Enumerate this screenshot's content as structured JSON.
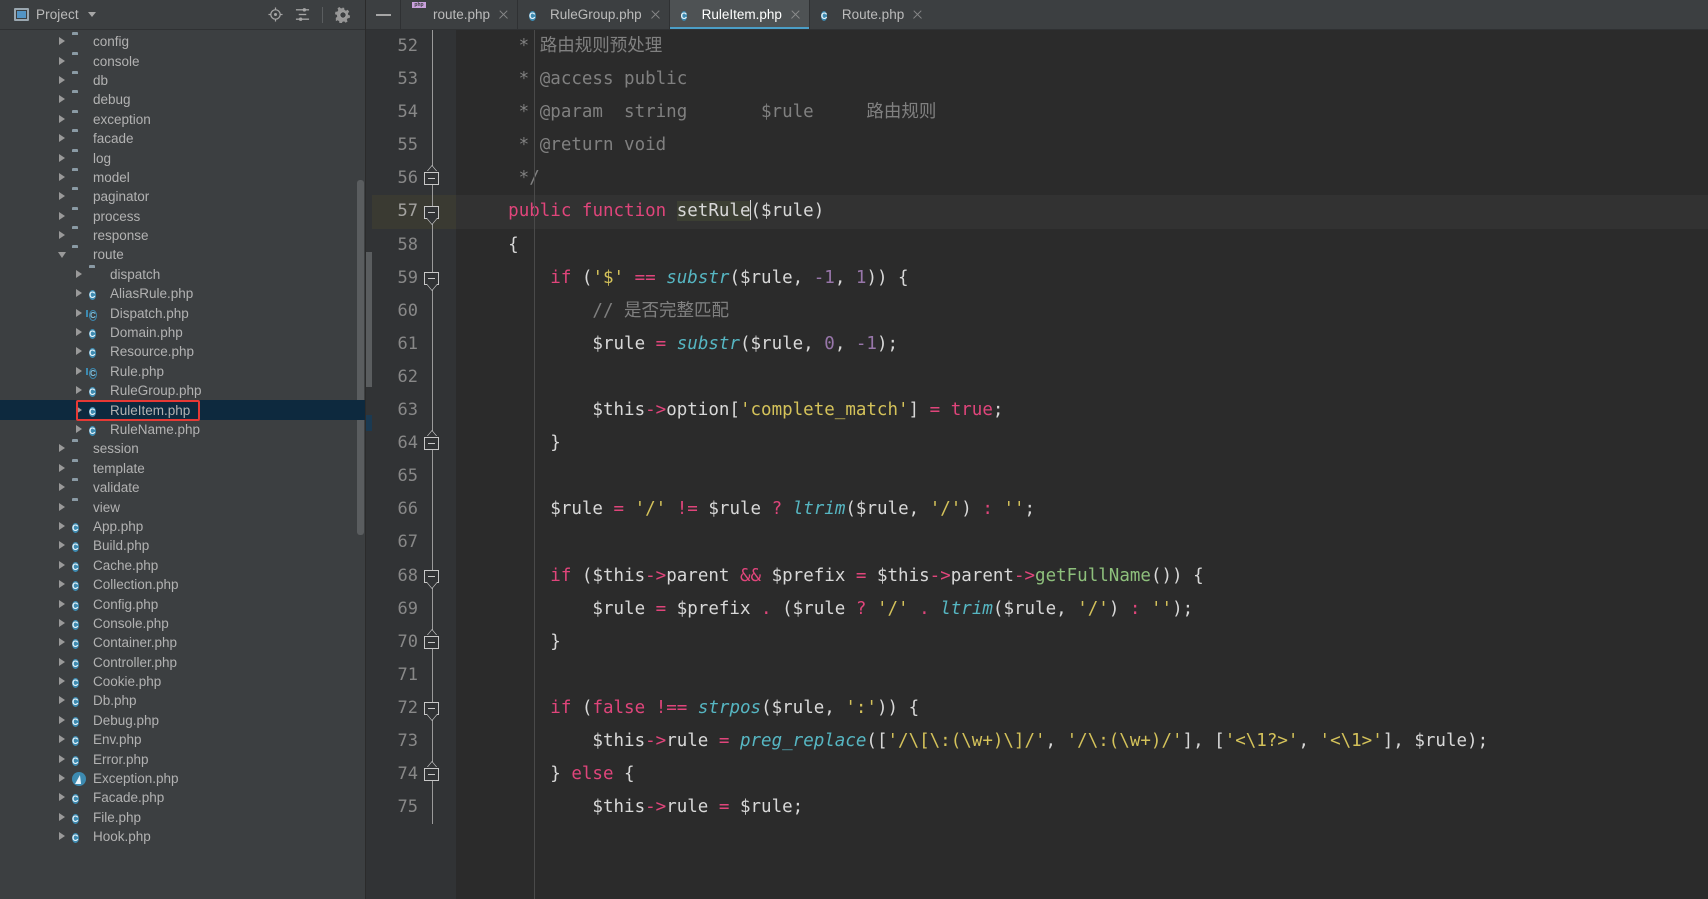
{
  "sidebar": {
    "title": "Project",
    "title_icon": "project-panel-icon",
    "actions": [
      {
        "name": "locate-icon",
        "label": "Select Opened File"
      },
      {
        "name": "collapse-all-icon",
        "label": "Collapse All"
      },
      {
        "name": "gear-icon",
        "label": "Settings"
      }
    ],
    "tree": [
      {
        "label": "config",
        "icon": "folder-icon",
        "arrow": "closed",
        "indent": 1
      },
      {
        "label": "console",
        "icon": "folder-icon",
        "arrow": "closed",
        "indent": 1
      },
      {
        "label": "db",
        "icon": "folder-icon",
        "arrow": "closed",
        "indent": 1
      },
      {
        "label": "debug",
        "icon": "folder-icon",
        "arrow": "closed",
        "indent": 1
      },
      {
        "label": "exception",
        "icon": "folder-icon",
        "arrow": "closed",
        "indent": 1
      },
      {
        "label": "facade",
        "icon": "folder-icon",
        "arrow": "closed",
        "indent": 1
      },
      {
        "label": "log",
        "icon": "folder-icon",
        "arrow": "closed",
        "indent": 1
      },
      {
        "label": "model",
        "icon": "folder-icon",
        "arrow": "closed",
        "indent": 1
      },
      {
        "label": "paginator",
        "icon": "folder-icon",
        "arrow": "closed",
        "indent": 1
      },
      {
        "label": "process",
        "icon": "folder-icon",
        "arrow": "closed",
        "indent": 1
      },
      {
        "label": "response",
        "icon": "folder-icon",
        "arrow": "closed",
        "indent": 1
      },
      {
        "label": "route",
        "icon": "folder-icon",
        "arrow": "open",
        "indent": 1
      },
      {
        "label": "dispatch",
        "icon": "folder-icon",
        "arrow": "closed",
        "indent": 2
      },
      {
        "label": "AliasRule.php",
        "icon": "php-class-icon",
        "arrow": "closed",
        "indent": 2
      },
      {
        "label": "Dispatch.php",
        "icon": "php-abstract-class-icon",
        "arrow": "closed",
        "indent": 2
      },
      {
        "label": "Domain.php",
        "icon": "php-class-icon",
        "arrow": "closed",
        "indent": 2
      },
      {
        "label": "Resource.php",
        "icon": "php-class-icon",
        "arrow": "closed",
        "indent": 2
      },
      {
        "label": "Rule.php",
        "icon": "php-abstract-class-icon",
        "arrow": "closed",
        "indent": 2
      },
      {
        "label": "RuleGroup.php",
        "icon": "php-class-icon",
        "arrow": "closed",
        "indent": 2
      },
      {
        "label": "RuleItem.php",
        "icon": "php-class-icon",
        "arrow": "closed",
        "indent": 2,
        "selected": true,
        "annotated": true
      },
      {
        "label": "RuleName.php",
        "icon": "php-class-icon",
        "arrow": "closed",
        "indent": 2
      },
      {
        "label": "session",
        "icon": "folder-icon",
        "arrow": "closed",
        "indent": 1
      },
      {
        "label": "template",
        "icon": "folder-icon",
        "arrow": "closed",
        "indent": 1
      },
      {
        "label": "validate",
        "icon": "folder-icon",
        "arrow": "closed",
        "indent": 1
      },
      {
        "label": "view",
        "icon": "folder-icon",
        "arrow": "closed",
        "indent": 1
      },
      {
        "label": "App.php",
        "icon": "php-class-icon",
        "arrow": "closed",
        "indent": 1
      },
      {
        "label": "Build.php",
        "icon": "php-class-icon",
        "arrow": "closed",
        "indent": 1
      },
      {
        "label": "Cache.php",
        "icon": "php-class-icon",
        "arrow": "closed",
        "indent": 1
      },
      {
        "label": "Collection.php",
        "icon": "php-class-icon",
        "arrow": "closed",
        "indent": 1
      },
      {
        "label": "Config.php",
        "icon": "php-class-icon",
        "arrow": "closed",
        "indent": 1
      },
      {
        "label": "Console.php",
        "icon": "php-class-icon",
        "arrow": "closed",
        "indent": 1
      },
      {
        "label": "Container.php",
        "icon": "php-class-icon",
        "arrow": "closed",
        "indent": 1
      },
      {
        "label": "Controller.php",
        "icon": "php-class-icon",
        "arrow": "closed",
        "indent": 1
      },
      {
        "label": "Cookie.php",
        "icon": "php-class-icon",
        "arrow": "closed",
        "indent": 1
      },
      {
        "label": "Db.php",
        "icon": "php-class-icon",
        "arrow": "closed",
        "indent": 1
      },
      {
        "label": "Debug.php",
        "icon": "php-class-icon",
        "arrow": "closed",
        "indent": 1
      },
      {
        "label": "Env.php",
        "icon": "php-class-icon",
        "arrow": "closed",
        "indent": 1
      },
      {
        "label": "Error.php",
        "icon": "php-class-icon",
        "arrow": "closed",
        "indent": 1
      },
      {
        "label": "Exception.php",
        "icon": "php-exception-icon",
        "arrow": "closed",
        "indent": 1
      },
      {
        "label": "Facade.php",
        "icon": "php-class-icon",
        "arrow": "closed",
        "indent": 1
      },
      {
        "label": "File.php",
        "icon": "php-class-icon",
        "arrow": "closed",
        "indent": 1
      },
      {
        "label": "Hook.php",
        "icon": "php-class-icon",
        "arrow": "closed",
        "indent": 1
      }
    ]
  },
  "tabs": [
    {
      "label": "route.php",
      "icon": "php-file-icon",
      "active": false
    },
    {
      "label": "RuleGroup.php",
      "icon": "php-class-icon",
      "active": false
    },
    {
      "label": "RuleItem.php",
      "icon": "php-class-icon",
      "active": true
    },
    {
      "label": "Route.php",
      "icon": "php-class-icon",
      "active": false
    }
  ],
  "editor": {
    "current_line": 57,
    "first_line": 52,
    "lines": [
      {
        "n": 52,
        "fold": null,
        "tokens": [
          {
            "t": "     * ",
            "c": "c-com"
          },
          {
            "t": "路由规则预处理",
            "c": "c-com"
          }
        ]
      },
      {
        "n": 53,
        "fold": null,
        "tokens": [
          {
            "t": "     * @access public",
            "c": "c-com"
          }
        ]
      },
      {
        "n": 54,
        "fold": null,
        "tokens": [
          {
            "t": "     * @param  string       $rule     路由规则",
            "c": "c-com"
          }
        ]
      },
      {
        "n": 55,
        "fold": null,
        "tokens": [
          {
            "t": "     * @return void",
            "c": "c-com"
          }
        ]
      },
      {
        "n": 56,
        "fold": "end",
        "tokens": [
          {
            "t": "     */",
            "c": "c-com"
          }
        ]
      },
      {
        "n": 57,
        "fold": "start",
        "tokens": [
          {
            "t": "    ",
            "c": "c-def"
          },
          {
            "t": "public function ",
            "c": "c-kw2"
          },
          {
            "t": "setRule",
            "c": "c-white idhl"
          },
          {
            "t": "CARET",
            "c": "caret"
          },
          {
            "t": "($rule)",
            "c": "c-white"
          }
        ]
      },
      {
        "n": 58,
        "fold": null,
        "tokens": [
          {
            "t": "    {",
            "c": "c-white"
          }
        ]
      },
      {
        "n": 59,
        "fold": "start",
        "tokens": [
          {
            "t": "        ",
            "c": "c-def"
          },
          {
            "t": "if",
            "c": "c-kw2"
          },
          {
            "t": " (",
            "c": "c-white"
          },
          {
            "t": "'$'",
            "c": "c-str"
          },
          {
            "t": " ",
            "c": "c-def"
          },
          {
            "t": "==",
            "c": "c-op"
          },
          {
            "t": " ",
            "c": "c-def"
          },
          {
            "t": "substr",
            "c": "c-fn"
          },
          {
            "t": "($rule, ",
            "c": "c-white"
          },
          {
            "t": "-1",
            "c": "c-num"
          },
          {
            "t": ", ",
            "c": "c-white"
          },
          {
            "t": "1",
            "c": "c-num"
          },
          {
            "t": ")) {",
            "c": "c-white"
          }
        ]
      },
      {
        "n": 60,
        "fold": null,
        "tokens": [
          {
            "t": "            // 是否完整匹配",
            "c": "c-com"
          }
        ]
      },
      {
        "n": 61,
        "fold": null,
        "tokens": [
          {
            "t": "            $rule ",
            "c": "c-white"
          },
          {
            "t": "=",
            "c": "c-op"
          },
          {
            "t": " ",
            "c": "c-def"
          },
          {
            "t": "substr",
            "c": "c-fn"
          },
          {
            "t": "($rule, ",
            "c": "c-white"
          },
          {
            "t": "0",
            "c": "c-num"
          },
          {
            "t": ", ",
            "c": "c-white"
          },
          {
            "t": "-1",
            "c": "c-num"
          },
          {
            "t": ");",
            "c": "c-white"
          }
        ]
      },
      {
        "n": 62,
        "fold": null,
        "tokens": [
          {
            "t": "",
            "c": "c-def"
          }
        ]
      },
      {
        "n": 63,
        "fold": null,
        "tokens": [
          {
            "t": "            $this",
            "c": "c-white"
          },
          {
            "t": "->",
            "c": "c-arrow"
          },
          {
            "t": "option[",
            "c": "c-white"
          },
          {
            "t": "'complete_match'",
            "c": "c-str"
          },
          {
            "t": "] ",
            "c": "c-white"
          },
          {
            "t": "=",
            "c": "c-op"
          },
          {
            "t": " ",
            "c": "c-def"
          },
          {
            "t": "true",
            "c": "c-bool"
          },
          {
            "t": ";",
            "c": "c-white"
          }
        ]
      },
      {
        "n": 64,
        "fold": "end",
        "tokens": [
          {
            "t": "        }",
            "c": "c-white"
          }
        ]
      },
      {
        "n": 65,
        "fold": null,
        "tokens": [
          {
            "t": "",
            "c": "c-def"
          }
        ]
      },
      {
        "n": 66,
        "fold": null,
        "tokens": [
          {
            "t": "        $rule ",
            "c": "c-white"
          },
          {
            "t": "=",
            "c": "c-op"
          },
          {
            "t": " ",
            "c": "c-def"
          },
          {
            "t": "'/'",
            "c": "c-str"
          },
          {
            "t": " ",
            "c": "c-def"
          },
          {
            "t": "!=",
            "c": "c-op"
          },
          {
            "t": " $rule ",
            "c": "c-white"
          },
          {
            "t": "?",
            "c": "c-op"
          },
          {
            "t": " ",
            "c": "c-def"
          },
          {
            "t": "ltrim",
            "c": "c-fn"
          },
          {
            "t": "($rule, ",
            "c": "c-white"
          },
          {
            "t": "'/'",
            "c": "c-str"
          },
          {
            "t": ") ",
            "c": "c-white"
          },
          {
            "t": ":",
            "c": "c-op"
          },
          {
            "t": " ",
            "c": "c-def"
          },
          {
            "t": "''",
            "c": "c-str"
          },
          {
            "t": ";",
            "c": "c-white"
          }
        ]
      },
      {
        "n": 67,
        "fold": null,
        "tokens": [
          {
            "t": "",
            "c": "c-def"
          }
        ]
      },
      {
        "n": 68,
        "fold": "start",
        "tokens": [
          {
            "t": "        ",
            "c": "c-def"
          },
          {
            "t": "if",
            "c": "c-kw2"
          },
          {
            "t": " ($this",
            "c": "c-white"
          },
          {
            "t": "->",
            "c": "c-arrow"
          },
          {
            "t": "parent ",
            "c": "c-white"
          },
          {
            "t": "&&",
            "c": "c-op"
          },
          {
            "t": " $prefix ",
            "c": "c-white"
          },
          {
            "t": "=",
            "c": "c-op"
          },
          {
            "t": " $this",
            "c": "c-white"
          },
          {
            "t": "->",
            "c": "c-arrow"
          },
          {
            "t": "parent",
            "c": "c-white"
          },
          {
            "t": "->",
            "c": "c-arrow"
          },
          {
            "t": "getFullName",
            "c": "c-meth"
          },
          {
            "t": "()) {",
            "c": "c-white"
          }
        ]
      },
      {
        "n": 69,
        "fold": null,
        "tokens": [
          {
            "t": "            $rule ",
            "c": "c-white"
          },
          {
            "t": "=",
            "c": "c-op"
          },
          {
            "t": " $prefix ",
            "c": "c-white"
          },
          {
            "t": ".",
            "c": "c-op"
          },
          {
            "t": " ($rule ",
            "c": "c-white"
          },
          {
            "t": "?",
            "c": "c-op"
          },
          {
            "t": " ",
            "c": "c-def"
          },
          {
            "t": "'/'",
            "c": "c-str"
          },
          {
            "t": " ",
            "c": "c-def"
          },
          {
            "t": ".",
            "c": "c-op"
          },
          {
            "t": " ",
            "c": "c-def"
          },
          {
            "t": "ltrim",
            "c": "c-fn"
          },
          {
            "t": "($rule, ",
            "c": "c-white"
          },
          {
            "t": "'/'",
            "c": "c-str"
          },
          {
            "t": ") ",
            "c": "c-white"
          },
          {
            "t": ":",
            "c": "c-op"
          },
          {
            "t": " ",
            "c": "c-def"
          },
          {
            "t": "''",
            "c": "c-str"
          },
          {
            "t": ");",
            "c": "c-white"
          }
        ]
      },
      {
        "n": 70,
        "fold": "end",
        "tokens": [
          {
            "t": "        }",
            "c": "c-white"
          }
        ]
      },
      {
        "n": 71,
        "fold": null,
        "tokens": [
          {
            "t": "",
            "c": "c-def"
          }
        ]
      },
      {
        "n": 72,
        "fold": "start",
        "tokens": [
          {
            "t": "        ",
            "c": "c-def"
          },
          {
            "t": "if",
            "c": "c-kw2"
          },
          {
            "t": " (",
            "c": "c-white"
          },
          {
            "t": "false",
            "c": "c-bool"
          },
          {
            "t": " ",
            "c": "c-def"
          },
          {
            "t": "!==",
            "c": "c-op"
          },
          {
            "t": " ",
            "c": "c-def"
          },
          {
            "t": "strpos",
            "c": "c-fn"
          },
          {
            "t": "($rule, ",
            "c": "c-white"
          },
          {
            "t": "':'",
            "c": "c-str"
          },
          {
            "t": ")) {",
            "c": "c-white"
          }
        ]
      },
      {
        "n": 73,
        "fold": null,
        "tokens": [
          {
            "t": "            $this",
            "c": "c-white"
          },
          {
            "t": "->",
            "c": "c-arrow"
          },
          {
            "t": "rule ",
            "c": "c-white"
          },
          {
            "t": "=",
            "c": "c-op"
          },
          {
            "t": " ",
            "c": "c-def"
          },
          {
            "t": "preg_replace",
            "c": "c-fn"
          },
          {
            "t": "([",
            "c": "c-white"
          },
          {
            "t": "'/\\[\\:(\\w+)\\]/'",
            "c": "c-str"
          },
          {
            "t": ", ",
            "c": "c-white"
          },
          {
            "t": "'/\\:(\\w+)/'",
            "c": "c-str"
          },
          {
            "t": "], [",
            "c": "c-white"
          },
          {
            "t": "'<\\1?>'",
            "c": "c-str"
          },
          {
            "t": ", ",
            "c": "c-white"
          },
          {
            "t": "'<\\1>'",
            "c": "c-str"
          },
          {
            "t": "], $rule);",
            "c": "c-white"
          }
        ]
      },
      {
        "n": 74,
        "fold": "end",
        "tokens": [
          {
            "t": "        } ",
            "c": "c-white"
          },
          {
            "t": "else",
            "c": "c-kw2"
          },
          {
            "t": " {",
            "c": "c-white"
          }
        ]
      },
      {
        "n": 75,
        "fold": null,
        "tokens": [
          {
            "t": "            $this",
            "c": "c-white"
          },
          {
            "t": "->",
            "c": "c-arrow"
          },
          {
            "t": "rule ",
            "c": "c-white"
          },
          {
            "t": "=",
            "c": "c-op"
          },
          {
            "t": " $rule;",
            "c": "c-white"
          }
        ]
      }
    ]
  },
  "colors": {
    "accent": "#4b9ec7",
    "annotation": "#e53935",
    "selection": "#0d293e",
    "editor_bg": "#2b2b2b",
    "panel_bg": "#3c3f41"
  }
}
